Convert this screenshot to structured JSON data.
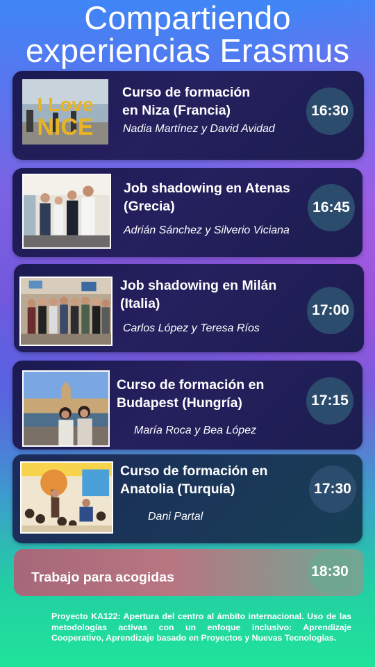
{
  "title": {
    "line1": "Compartiendo",
    "line2": "experiencias Erasmus"
  },
  "sessions": [
    {
      "title": "Curso de formación en Niza (Francia)",
      "title_line1": "Curso de formación",
      "title_line2": "en Niza (Francia)",
      "authors": "Nadia Martínez y David Avidad",
      "time": "16:30",
      "photo_text": "I Love NICE"
    },
    {
      "title": "Job shadowing en Atenas (Grecia)",
      "title_line1": "Job shadowing en Atenas",
      "title_line2": "(Grecia)",
      "authors": "Adrián Sánchez y Silverio Viciana",
      "time": "16:45"
    },
    {
      "title": "Job shadowing en Milán (Italia)",
      "title_line1": "Job shadowing en Milán",
      "title_line2": "(Italia)",
      "authors": "Carlos López y Teresa Ríos",
      "time": "17:00"
    },
    {
      "title": "Curso de formación en Budapest (Hungría)",
      "title_line1": "Curso de formación en",
      "title_line2": "Budapest (Hungría)",
      "authors": "María Roca y Bea López",
      "time": "17:15"
    },
    {
      "title": "Curso de formación en Anatolia (Turquía)",
      "title_line1": "Curso de formación en",
      "title_line2": "Anatolia (Turquía)",
      "authors": "Dani Partal",
      "time": "17:30"
    }
  ],
  "closing": {
    "label": "Trabajo para acogidas",
    "time": "18:30"
  },
  "footer": "Proyecto KA122: Apertura del centro al ámbito internacional. Uso de las metodologías activas con un enfoque inclusivo: Aprendizaje Cooperativo, Aprendizaje basado en Proyectos y Nuevas Tecnologías.",
  "colors": {
    "card": "#1f1d57",
    "time_circle": "#2c4c6e",
    "closing_card": "#b87681",
    "closing_time_circle": "#6fa68f"
  }
}
